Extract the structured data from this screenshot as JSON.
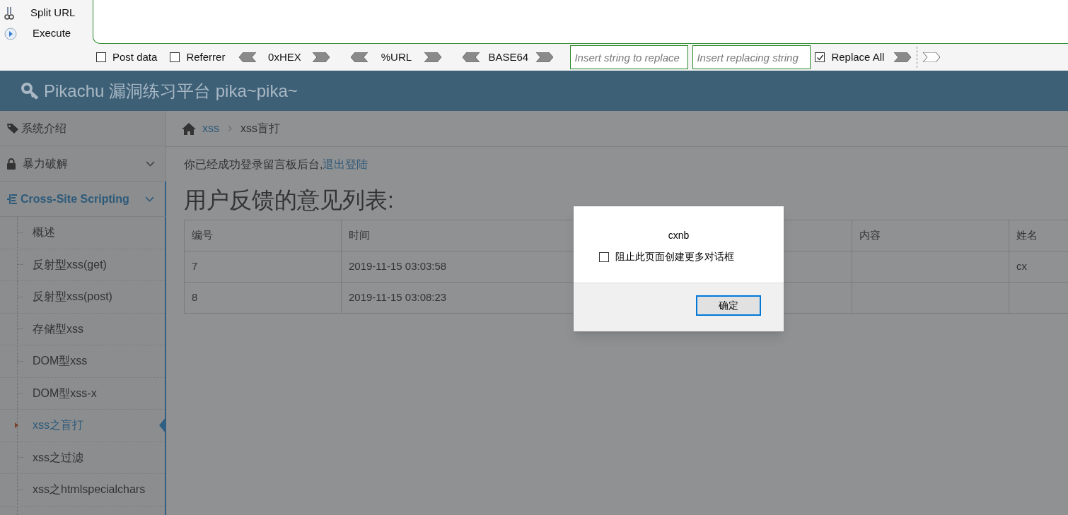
{
  "hackbar": {
    "actions": [
      {
        "kind": "split",
        "label": "Split URL"
      },
      {
        "kind": "execute",
        "label": "Execute"
      }
    ],
    "options": [
      {
        "kind": "checkbox",
        "label": "Post data",
        "checked": false
      },
      {
        "kind": "checkbox",
        "label": "Referrer",
        "checked": false
      },
      {
        "kind": "codec",
        "label": "0xHEX"
      },
      {
        "kind": "codec",
        "label": "%URL"
      },
      {
        "kind": "codec",
        "label": "BASE64"
      },
      {
        "kind": "field",
        "placeholder": "Insert string to replace"
      },
      {
        "kind": "field",
        "placeholder": "Insert replacing string"
      },
      {
        "kind": "checkbox",
        "label": "Replace All",
        "checked": true
      },
      {
        "kind": "arrows"
      }
    ]
  },
  "header": {
    "title": "Pikachu 漏洞练习平台 pika~pika~"
  },
  "sidebar": {
    "items": [
      {
        "kind": "link",
        "label": "系统介绍",
        "selected": false
      },
      {
        "kind": "group",
        "label": "暴力破解",
        "expanded": false,
        "selected": false
      },
      {
        "kind": "group",
        "label": "Cross-Site Scripting",
        "expanded": true,
        "selected": true,
        "children": [
          {
            "label": "概述",
            "selected": false
          },
          {
            "label": "反射型xss(get)",
            "selected": false
          },
          {
            "label": "反射型xss(post)",
            "selected": false
          },
          {
            "label": "存储型xss",
            "selected": false
          },
          {
            "label": "DOM型xss",
            "selected": false
          },
          {
            "label": "DOM型xss-x",
            "selected": false
          },
          {
            "label": "xss之盲打",
            "selected": true
          },
          {
            "label": "xss之过滤",
            "selected": false
          },
          {
            "label": "xss之htmlspecialchars",
            "selected": false
          }
        ]
      }
    ]
  },
  "breadcrumb": {
    "link": "xss",
    "current": "xss盲打"
  },
  "notice": {
    "text": "你已经成功登录留言板后台,",
    "link": "退出登陆"
  },
  "heading": "用户反馈的意见列表:",
  "table": {
    "columns": {
      "number": "编号",
      "time": "时间",
      "content": "内容",
      "name": "姓名"
    },
    "rows": [
      {
        "number": "7",
        "time": "2019-11-15 03:03:58",
        "name": "cx"
      },
      {
        "number": "8",
        "time": "2019-11-15 03:08:23"
      }
    ]
  },
  "dialog": {
    "message": "cxnb",
    "checkbox": {
      "label": "阻止此页面创建更多对话框",
      "checked": false
    },
    "button": "确定"
  }
}
